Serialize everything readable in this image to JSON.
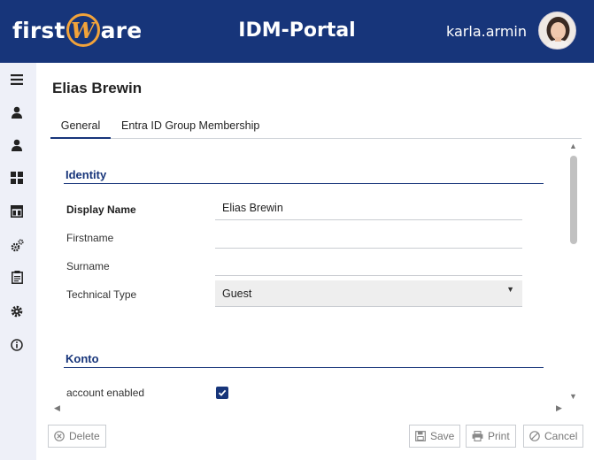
{
  "header": {
    "logo_prefix": "first",
    "logo_w": "W",
    "logo_suffix": "are",
    "app_title": "IDM-Portal",
    "username": "karla.armin"
  },
  "sidebar": {
    "items": [
      {
        "icon": "menu-icon"
      },
      {
        "icon": "user-icon"
      },
      {
        "icon": "user-icon"
      },
      {
        "icon": "dashboard-icon"
      },
      {
        "icon": "layout-icon"
      },
      {
        "icon": "gears-icon"
      },
      {
        "icon": "clipboard-icon"
      },
      {
        "icon": "settings-icon"
      },
      {
        "icon": "info-icon"
      }
    ]
  },
  "page": {
    "title": "Elias Brewin"
  },
  "tabs": [
    {
      "label": "General",
      "active": true
    },
    {
      "label": "Entra ID Group Membership",
      "active": false
    }
  ],
  "identity": {
    "section_title": "Identity",
    "display_name_label": "Display Name",
    "display_name_value": "Elias Brewin",
    "firstname_label": "Firstname",
    "firstname_value": "",
    "surname_label": "Surname",
    "surname_value": "",
    "technical_type_label": "Technical Type",
    "technical_type_value": "Guest"
  },
  "konto": {
    "section_title": "Konto",
    "account_enabled_label": "account enabled",
    "account_enabled": true
  },
  "footer": {
    "delete_label": "Delete",
    "save_label": "Save",
    "print_label": "Print",
    "cancel_label": "Cancel"
  },
  "colors": {
    "brand": "#17357a",
    "logo_accent": "#f2a33a",
    "sidebar_bg": "#eef0f8"
  }
}
